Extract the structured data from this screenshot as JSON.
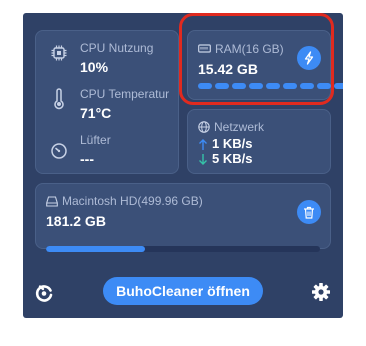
{
  "cpu": {
    "label": "CPU Nutzung",
    "value": "10%",
    "icon": "cpu-chip-icon"
  },
  "temperature": {
    "label": "CPU Temperatur",
    "value": "71°C",
    "icon": "thermometer-icon"
  },
  "fan": {
    "label": "Lüfter",
    "value": "---",
    "icon": "fan-gauge-icon"
  },
  "ram": {
    "label": "RAM(16 GB)",
    "value": "15.42 GB",
    "icon": "memory-icon",
    "action_icon": "lightning-bolt-icon",
    "segments_total": 9,
    "segments_filled": 9
  },
  "network": {
    "label": "Netzwerk",
    "upload": "1 KB/s",
    "download": "5 KB/s",
    "icon": "globe-icon",
    "upload_icon": "arrow-up-icon",
    "download_icon": "arrow-down-icon"
  },
  "disk": {
    "label": "Macintosh HD(499.96 GB)",
    "value": "181.2 GB",
    "icon": "disk-icon",
    "action_icon": "trash-icon",
    "used_fraction": 0.36
  },
  "footer": {
    "open_button_label": "BuhoCleaner öffnen",
    "logo_icon": "buho-logo-icon",
    "settings_icon": "gear-icon"
  },
  "colors": {
    "panel": "#2f4166",
    "card": "#3b5078",
    "accent": "#3d8bf5",
    "upload_arrow": "#3d8bf5",
    "download_arrow": "#35c2a8",
    "highlight": "#e02a1f"
  }
}
